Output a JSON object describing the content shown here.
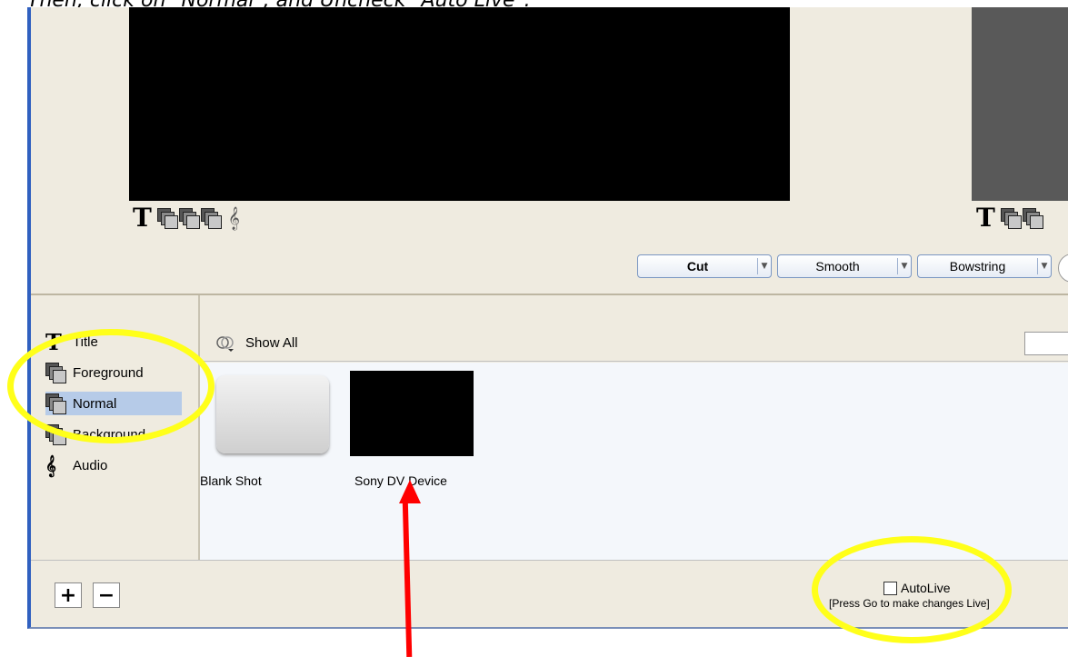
{
  "instruction": "Then, click on \"Normal\", and Uncheck \"Auto Live\".",
  "source_icons": {
    "title_glyph": "T",
    "audio_glyph": "𝄞",
    "icons": [
      "title-icon",
      "foreground-layer-icon",
      "normal-layer-icon",
      "background-layer-icon",
      "audio-icon"
    ]
  },
  "transitions": [
    {
      "label": "Cut"
    },
    {
      "label": "Smooth"
    },
    {
      "label": "Bowstring"
    }
  ],
  "layers": {
    "title": "Title",
    "foreground": "Foreground",
    "normal": "Normal",
    "background": "Background",
    "audio": "Audio",
    "title_glyph": "T",
    "audio_glyph": "𝄞",
    "selected": "Normal"
  },
  "toolbar": {
    "show_all": "Show All"
  },
  "shots": [
    {
      "label": "Blank Shot"
    },
    {
      "label": "Sony DV Device"
    }
  ],
  "bottom": {
    "add": "+",
    "remove": "−",
    "autolive_label": "AutoLive",
    "autolive_checked": false,
    "autolive_hint": "[Press Go to make changes Live]"
  },
  "annotation_colors": {
    "highlight": "#ffff1a",
    "arrow": "#ff0000"
  }
}
